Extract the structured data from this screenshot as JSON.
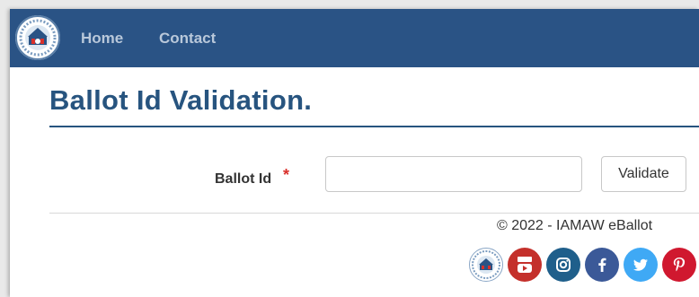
{
  "nav": {
    "items": [
      {
        "label": "Home"
      },
      {
        "label": "Contact"
      }
    ]
  },
  "page": {
    "title": "Ballot Id Validation."
  },
  "form": {
    "ballot_label": "Ballot Id",
    "required_marker": "*",
    "ballot_value": "",
    "validate_label": "Validate"
  },
  "footer": {
    "copyright": "© 2022 - IAMAW eBallot",
    "social": [
      {
        "icon": "iamaw-seal-icon",
        "color": "#ffffff"
      },
      {
        "icon": "youtube-icon",
        "color": "#c4302b"
      },
      {
        "icon": "instagram-icon",
        "color": "#1f5f8b"
      },
      {
        "icon": "facebook-icon",
        "color": "#3b5998"
      },
      {
        "icon": "twitter-icon",
        "color": "#3fa9f5"
      },
      {
        "icon": "pinterest-icon",
        "color": "#d0182f"
      }
    ]
  },
  "colors": {
    "navbar": "#2a5385",
    "title": "#27547f",
    "required": "#d9302b"
  }
}
